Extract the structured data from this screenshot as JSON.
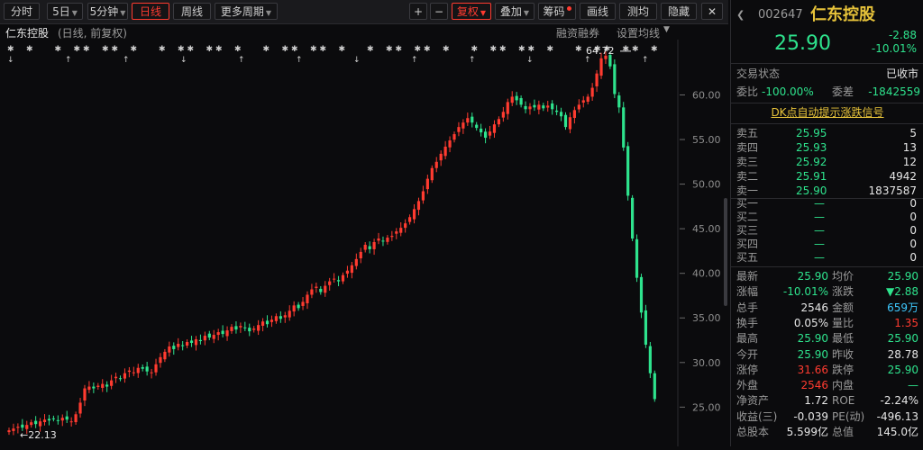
{
  "toolbar": {
    "periods": [
      {
        "label": "分时",
        "active": false,
        "dropdown": false
      },
      {
        "label": "5日",
        "active": false,
        "dropdown": true
      },
      {
        "label": "5分钟",
        "active": false,
        "dropdown": true
      },
      {
        "label": "日线",
        "active": true,
        "dropdown": false
      },
      {
        "label": "周线",
        "active": false,
        "dropdown": false
      },
      {
        "label": "更多周期",
        "active": false,
        "dropdown": true
      }
    ],
    "zoom_in": "+",
    "zoom_out": "−",
    "adjust": "复权",
    "overlay": "叠加",
    "chips": "筹码",
    "draw": "画线",
    "diagnose": "测均",
    "hide": "隐藏",
    "close": "✕"
  },
  "chart_header": {
    "name": "仁东控股",
    "mode": "(日线, 前复权)",
    "margin": "融资融券",
    "ma_settings": "设置均线"
  },
  "colors": {
    "up": "#ff3b30",
    "down": "#2ee38d",
    "accent": "#e7c33a"
  },
  "chart_data": {
    "type": "candlestick",
    "ylim": [
      21,
      66
    ],
    "yticks": [
      "60.00",
      "55.00",
      "50.00",
      "45.00",
      "40.00",
      "35.00",
      "30.00",
      "25.00"
    ],
    "max_label": "64.72",
    "min_label": "22.13",
    "approx_closes": [
      22.4,
      22.6,
      22.8,
      22.7,
      23,
      23.3,
      23.1,
      23.4,
      23.6,
      23.5,
      23.7,
      23.5,
      23.8,
      23.6,
      23.4,
      24.2,
      25.5,
      27.1,
      27.3,
      27.1,
      27.4,
      27.6,
      27.3,
      28,
      28.4,
      28.2,
      28.8,
      29.1,
      28.9,
      29.4,
      29.3,
      29,
      28.9,
      29.8,
      30.6,
      31.2,
      31.8,
      31.5,
      32.1,
      31.9,
      32.3,
      32.2,
      32.6,
      32.4,
      33,
      32.8,
      33.1,
      33.4,
      33.2,
      33.6,
      34,
      33.7,
      34.1,
      33.9,
      33.5,
      33.8,
      34.2,
      34.6,
      34.3,
      34.8,
      35.2,
      34.9,
      35.3,
      35.8,
      36.4,
      36.1,
      36.8,
      37.6,
      38.2,
      38.5,
      37.9,
      38.6,
      39.1,
      39.4,
      39.1,
      39.8,
      40.3,
      40.9,
      41.6,
      42.4,
      43.2,
      42.7,
      43.5,
      43.9,
      43.6,
      44,
      44.2,
      44.7,
      45.1,
      45.6,
      46.3,
      47.2,
      48.1,
      49.2,
      50.6,
      51.8,
      52.5,
      53.4,
      54.2,
      54.9,
      55.6,
      56.4,
      56.9,
      57.4,
      56.9,
      56.3,
      55.8,
      55.2,
      55.9,
      56.7,
      57.3,
      58.1,
      59.2,
      59.8,
      59.4,
      58.9,
      58.4,
      58.7,
      58.6,
      58.9,
      58.5,
      58.8,
      58.4,
      58.1,
      57.6,
      56.4,
      57.5,
      58.3,
      58.9,
      59.4,
      59.8,
      60.8,
      62.4,
      64.1,
      64.4,
      63.2,
      60.1,
      58.6,
      54.1,
      48.7,
      43.9,
      39.5,
      35.6,
      32.0,
      28.8,
      25.9
    ]
  },
  "quote": {
    "code": "002647",
    "name": "仁东控股",
    "price": "25.90",
    "change": "-2.88",
    "change_pct": "-10.01%",
    "status_label": "交易状态",
    "status_value": "已收市",
    "wb_label": "委比",
    "wb_value": "-100.00%",
    "wc_label": "委差",
    "wc_value": "-1842559",
    "dk_signal": "DK点自动提示涨跌信号",
    "asks": [
      {
        "label": "卖五",
        "price": "25.95",
        "vol": "5"
      },
      {
        "label": "卖四",
        "price": "25.93",
        "vol": "13"
      },
      {
        "label": "卖三",
        "price": "25.92",
        "vol": "12"
      },
      {
        "label": "卖二",
        "price": "25.91",
        "vol": "4942"
      },
      {
        "label": "卖一",
        "price": "25.90",
        "vol": "1837587"
      }
    ],
    "bids": [
      {
        "label": "买一",
        "price": "—",
        "vol": "0"
      },
      {
        "label": "买二",
        "price": "—",
        "vol": "0"
      },
      {
        "label": "买三",
        "price": "—",
        "vol": "0"
      },
      {
        "label": "买四",
        "price": "—",
        "vol": "0"
      },
      {
        "label": "买五",
        "price": "—",
        "vol": "0"
      }
    ],
    "stats": [
      {
        "l1": "最新",
        "v1": "25.90",
        "c1": "green",
        "l2": "均价",
        "v2": "25.90",
        "c2": "green"
      },
      {
        "l1": "涨幅",
        "v1": "-10.01%",
        "c1": "green",
        "l2": "涨跌",
        "v2": "▼2.88",
        "c2": "green"
      },
      {
        "l1": "总手",
        "v1": "2546",
        "c1": "white",
        "l2": "金额",
        "v2": "659万",
        "c2": "cyan"
      },
      {
        "l1": "换手",
        "v1": "0.05%",
        "c1": "white",
        "l2": "量比",
        "v2": "1.35",
        "c2": "red"
      },
      {
        "l1": "最高",
        "v1": "25.90",
        "c1": "green",
        "l2": "最低",
        "v2": "25.90",
        "c2": "green"
      },
      {
        "l1": "今开",
        "v1": "25.90",
        "c1": "green",
        "l2": "昨收",
        "v2": "28.78",
        "c2": "white"
      },
      {
        "l1": "涨停",
        "v1": "31.66",
        "c1": "red",
        "l2": "跌停",
        "v2": "25.90",
        "c2": "green"
      },
      {
        "l1": "外盘",
        "v1": "2546",
        "c1": "red",
        "l2": "内盘",
        "v2": "—",
        "c2": "green"
      },
      {
        "l1": "净资产",
        "v1": "1.72",
        "c1": "white",
        "l2": "ROE",
        "v2": "-2.24%",
        "c2": "white"
      },
      {
        "l1": "收益(三)",
        "v1": "-0.039",
        "c1": "white",
        "l2": "PE(动)",
        "v2": "-496.13",
        "c2": "white"
      },
      {
        "l1": "总股本",
        "v1": "5.599亿",
        "c1": "white",
        "l2": "总值",
        "v2": "145.0亿",
        "c2": "white"
      }
    ]
  }
}
